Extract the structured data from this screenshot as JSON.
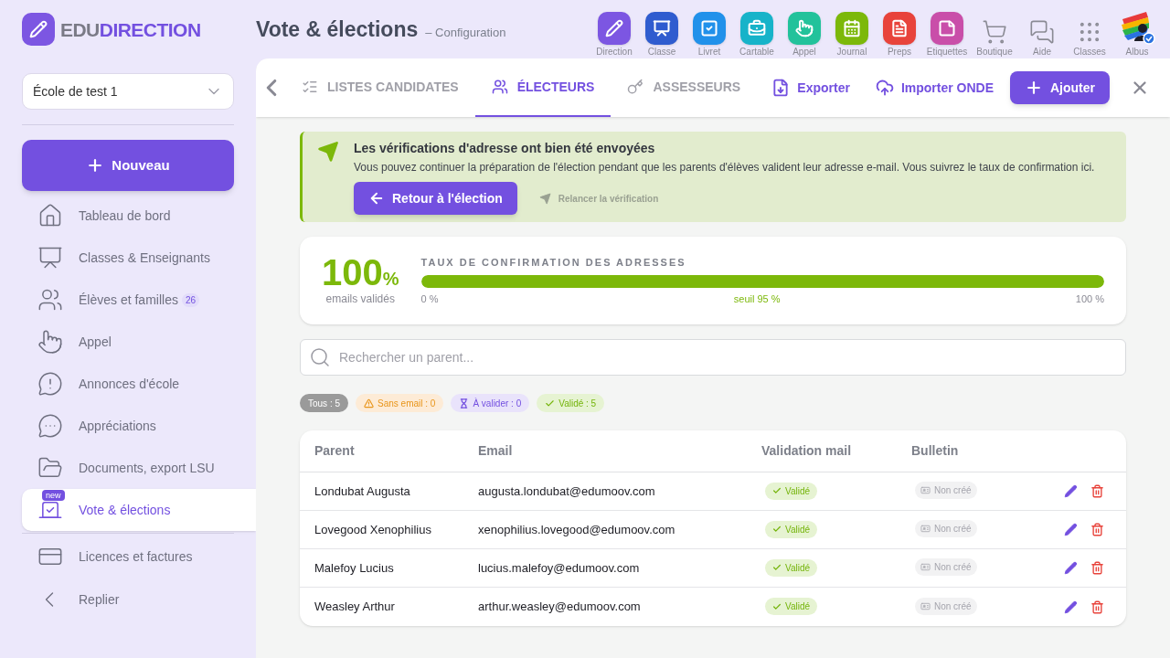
{
  "logo": {
    "prefix": "EDU",
    "name": "DIRECTION"
  },
  "page": {
    "title": "Vote & élections",
    "subtitle": "– Configuration"
  },
  "apps": [
    {
      "label": "Direction",
      "kind": "tile",
      "color": "#7c56e2"
    },
    {
      "label": "Classe",
      "kind": "tile",
      "color": "#2f5ccf"
    },
    {
      "label": "Livret",
      "kind": "tile",
      "color": "#2191ea"
    },
    {
      "label": "Cartable",
      "kind": "tile",
      "color": "#17b3c9"
    },
    {
      "label": "Appel",
      "kind": "tile",
      "color": "#22c29b"
    },
    {
      "label": "Journal",
      "kind": "tile",
      "color": "#7cb80a"
    },
    {
      "label": "Preps",
      "kind": "tile",
      "color": "#e8433b"
    },
    {
      "label": "Etiquettes",
      "kind": "tile",
      "color": "#c94ea9"
    },
    {
      "label": "Boutique",
      "kind": "plain"
    },
    {
      "label": "Aide",
      "kind": "plain"
    },
    {
      "label": "Classes",
      "kind": "plain"
    },
    {
      "label": "Albus",
      "kind": "avatar"
    }
  ],
  "sidebar": {
    "school": "École de test 1",
    "new_button": "Nouveau",
    "items": [
      {
        "label": "Tableau de bord",
        "selected": false
      },
      {
        "label": "Classes & Enseignants",
        "selected": false
      },
      {
        "label": "Élèves et familles",
        "selected": false,
        "badge": "26"
      },
      {
        "label": "Appel",
        "selected": false
      },
      {
        "label": "Annonces d'école",
        "selected": false
      },
      {
        "label": "Appréciations",
        "selected": false
      },
      {
        "label": "Documents, export LSU",
        "selected": false
      },
      {
        "label": "Vote & élections",
        "selected": true,
        "tag": "new"
      },
      {
        "label": "Licences et factures",
        "selected": false
      }
    ],
    "collapse": "Replier"
  },
  "tabs": [
    {
      "label": "LISTES CANDIDATES",
      "selected": false
    },
    {
      "label": "ÉLECTEURS",
      "selected": true
    },
    {
      "label": "ASSESSEURS",
      "selected": false
    }
  ],
  "actions": [
    "Exporter",
    "Importer ONDE"
  ],
  "add_button": "Ajouter",
  "alert": {
    "title": "Les vérifications d'adresse ont bien été envoyées",
    "text": "Vous pouvez continuer la préparation de l'élection pendant que les parents d'élèves valident leur adresse e-mail. Vous suivrez le taux de confirmation ici.",
    "primary": "Retour à l'élection",
    "secondary": "Relancer la vérification"
  },
  "rate": {
    "value": "100",
    "unit": "%",
    "caption": "emails validés",
    "title": "TAUX DE CONFIRMATION DES ADRESSES",
    "level": 1,
    "min": "0 %",
    "threshold": "seuil 95 %",
    "max": "100 %"
  },
  "search": {
    "placeholder": "Rechercher un parent..."
  },
  "filters": [
    {
      "label": "Tous : 5",
      "kind": "all",
      "selected": true
    },
    {
      "label": "Sans email : 0",
      "kind": "warning",
      "selected": false
    },
    {
      "label": "À valider : 0",
      "kind": "pending",
      "selected": false
    },
    {
      "label": "Validé : 5",
      "kind": "valid",
      "selected": false
    }
  ],
  "table": {
    "columns": [
      "Parent",
      "Email",
      "Validation mail",
      "Bulletin"
    ],
    "rows": [
      {
        "parent": "Londubat Augusta",
        "email": "augusta.londubat@edumoov.com",
        "validation": "Validé",
        "bulletin": "Non créé"
      },
      {
        "parent": "Lovegood Xenophilius",
        "email": "xenophilius.lovegood@edumoov.com",
        "validation": "Validé",
        "bulletin": "Non créé"
      },
      {
        "parent": "Malefoy Lucius",
        "email": "lucius.malefoy@edumoov.com",
        "validation": "Validé",
        "bulletin": "Non créé"
      },
      {
        "parent": "Weasley Arthur",
        "email": "arthur.weasley@edumoov.com",
        "validation": "Validé",
        "bulletin": "Non créé"
      }
    ]
  }
}
